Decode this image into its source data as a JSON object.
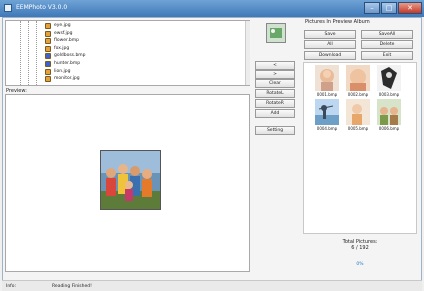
{
  "window": {
    "title": "EEMPhoto V3.0.0"
  },
  "files": [
    {
      "name": "eye.jpg",
      "color": "#e3a23c"
    },
    {
      "name": "ewsf.jpg",
      "color": "#e3a23c"
    },
    {
      "name": "flower.bmp",
      "color": "#e3a23c"
    },
    {
      "name": "fox.jpg",
      "color": "#e3a23c"
    },
    {
      "name": "goldboss.bmp",
      "color": "#3d63c9"
    },
    {
      "name": "hunter.bmp",
      "color": "#3d63c9"
    },
    {
      "name": "lion.jpg",
      "color": "#e3a23c"
    },
    {
      "name": "monitor.jpg",
      "color": "#e3a23c"
    }
  ],
  "preview": {
    "label": "Preview:"
  },
  "tools": {
    "up_label": "<",
    "down_label": ">",
    "clear_label": "Clear",
    "rotate_l_label": "RotateL",
    "rotate_r_label": "RotateR",
    "add_label": "Add",
    "setting_label": "Setting"
  },
  "album": {
    "label": "Pictures In Preview Album",
    "save_label": "Save",
    "saveall_label": "SaveAll",
    "all_label": "All",
    "delete_label": "Delete",
    "download_label": "Download",
    "exit_label": "Exit",
    "thumbnails": [
      {
        "name": "0001.bmp"
      },
      {
        "name": "0002.bmp"
      },
      {
        "name": "0003.bmp"
      },
      {
        "name": "0004.bmp"
      },
      {
        "name": "0005.bmp"
      },
      {
        "name": "0006.bmp"
      }
    ]
  },
  "total": {
    "label": "Total Pictures:",
    "count": "6 / 192"
  },
  "progress": {
    "text": "0%"
  },
  "status": {
    "key": "Info:",
    "value": "Reading Finished!"
  }
}
